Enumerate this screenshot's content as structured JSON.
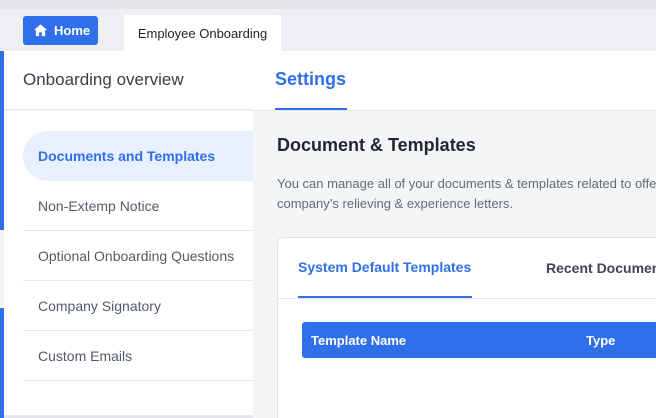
{
  "topbar": {
    "home_label": "Home",
    "tab_label": "Employee Onboarding"
  },
  "header": {
    "section_title": "Onboarding overview",
    "active_tab": "Settings"
  },
  "sidebar": {
    "items": [
      {
        "label": "Documents and Templates",
        "active": true
      },
      {
        "label": "Non-Extemp Notice",
        "active": false
      },
      {
        "label": "Optional Onboarding Questions",
        "active": false
      },
      {
        "label": "Company Signatory",
        "active": false
      },
      {
        "label": "Custom Emails",
        "active": false
      }
    ]
  },
  "main": {
    "title": "Document & Templates",
    "description": "You can manage all of your documents & templates related to offer letters, company’s relieving & experience letters.",
    "tabs": [
      {
        "label": "System Default Templates",
        "active": true
      },
      {
        "label": "Recent Documents",
        "active": false
      }
    ],
    "table": {
      "columns": [
        "Template Name",
        "Type"
      ]
    }
  },
  "colors": {
    "accent": "#2f6fe9",
    "active_item_bg": "#e8efff",
    "page_bg": "#f4f5f7"
  },
  "icons": {
    "home": "home-icon"
  }
}
